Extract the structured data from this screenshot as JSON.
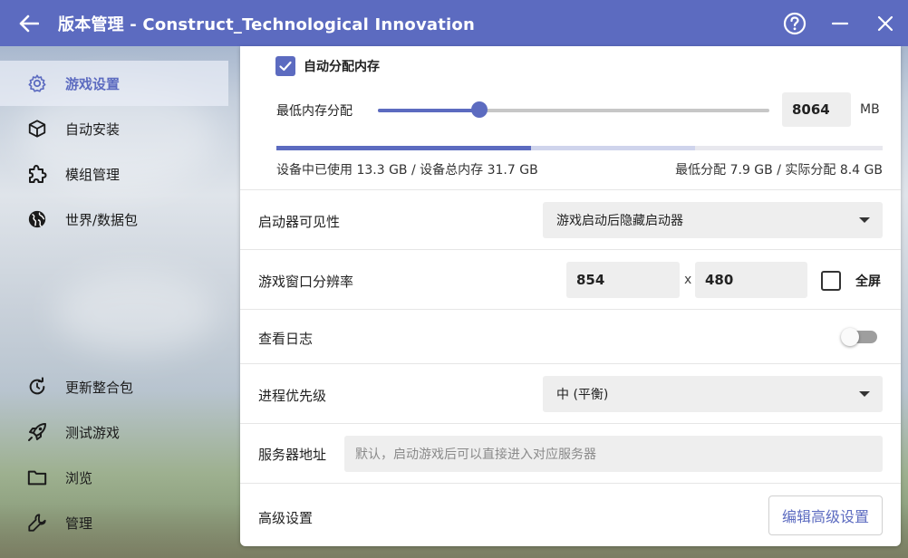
{
  "window": {
    "title": "版本管理 - Construct_Technological Innovation"
  },
  "sidebar": {
    "top_items": [
      {
        "label": "游戏设置",
        "icon": "gear-icon",
        "active": true
      },
      {
        "label": "自动安装",
        "icon": "cube-icon",
        "active": false
      },
      {
        "label": "模组管理",
        "icon": "puzzle-icon",
        "active": false
      },
      {
        "label": "世界/数据包",
        "icon": "globe-icon",
        "active": false
      }
    ],
    "bottom_items": [
      {
        "label": "更新整合包",
        "icon": "refresh-icon"
      },
      {
        "label": "测试游戏",
        "icon": "rocket-icon"
      },
      {
        "label": "浏览",
        "icon": "folder-icon"
      },
      {
        "label": "管理",
        "icon": "wrench-icon"
      }
    ]
  },
  "memory": {
    "auto_allocate_label": "自动分配内存",
    "auto_allocate_checked": true,
    "min_label": "最低内存分配",
    "min_value": "8064",
    "unit": "MB",
    "slider_fraction": 0.26,
    "used_fraction": 0.42,
    "allocated_fraction": 0.69,
    "usage_text": "设备中已使用 13.3 GB / 设备总内存 31.7 GB",
    "alloc_text": "最低分配 7.9 GB / 实际分配 8.4 GB"
  },
  "launcher_visibility": {
    "label": "启动器可见性",
    "value": "游戏启动后隐藏启动器"
  },
  "resolution": {
    "label": "游戏窗口分辨率",
    "width": "854",
    "separator": "x",
    "height": "480",
    "fullscreen_label": "全屏",
    "fullscreen_checked": false
  },
  "log": {
    "label": "查看日志",
    "enabled": false
  },
  "priority": {
    "label": "进程优先级",
    "value": "中 (平衡)"
  },
  "server": {
    "label": "服务器地址",
    "placeholder": "默认，启动游戏后可以直接进入对应服务器"
  },
  "advanced": {
    "label": "高级设置",
    "button": "编辑高级设置"
  },
  "colors": {
    "accent": "#5c6bc0"
  }
}
